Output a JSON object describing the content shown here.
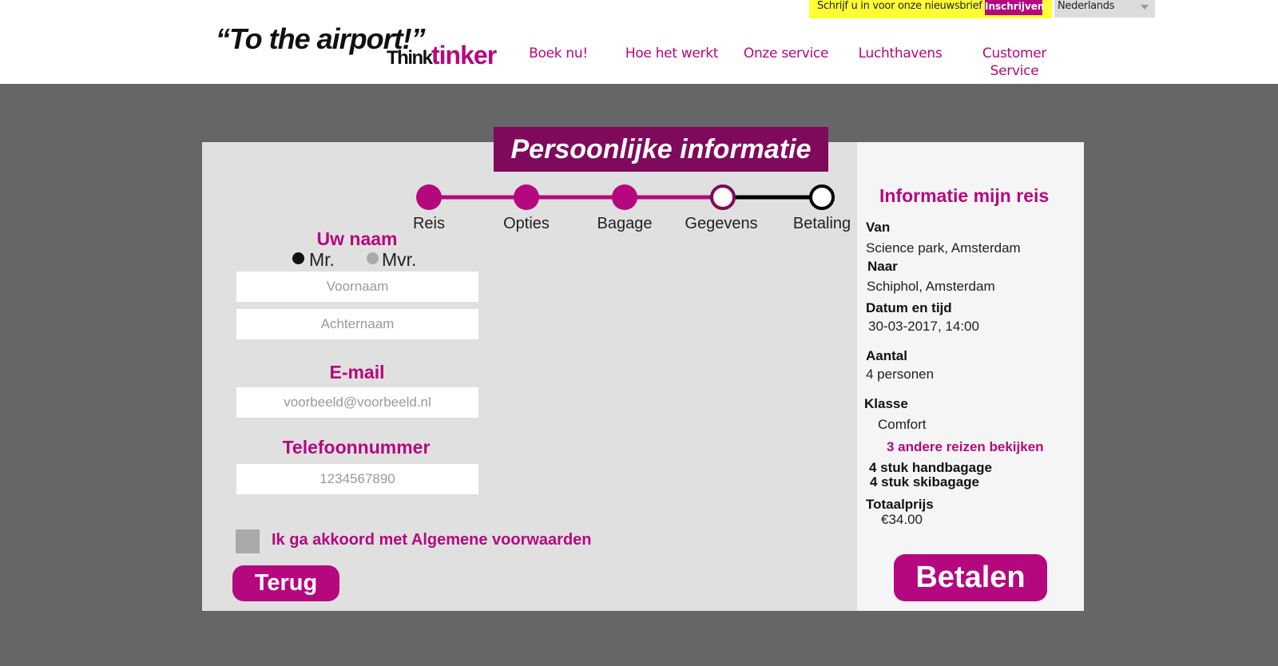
{
  "header": {
    "newsletter_text": "Schrijf u in voor onze nieuwsbrief",
    "newsletter_button": "Inschrijven",
    "language": "Nederlands",
    "logo_quote": "“To the airport!”",
    "logo_think": "Think",
    "logo_tinker": "tinker",
    "nav": [
      "Boek nu!",
      "Hoe het werkt",
      "Onze service",
      "Luchthavens",
      "Customer",
      "Service"
    ]
  },
  "page_title": "Persoonlijke informatie",
  "steps": [
    {
      "label": "Reis",
      "state": "done"
    },
    {
      "label": "Opties",
      "state": "done"
    },
    {
      "label": "Bagage",
      "state": "done"
    },
    {
      "label": "Gegevens",
      "state": "current"
    },
    {
      "label": "Betaling",
      "state": "todo"
    }
  ],
  "form": {
    "name_heading": "Uw naam",
    "title_options": [
      "Mr.",
      "Mvr."
    ],
    "title_selected": "Mr.",
    "first_name_placeholder": "Voornaam",
    "last_name_placeholder": "Achternaam",
    "email_heading": "E-mail",
    "email_placeholder": "voorbeeld@voorbeeld.nl",
    "phone_heading": "Telefoonnummer",
    "phone_placeholder": "1234567890",
    "agree_label": "Ik ga akkoord met Algemene voorwaarden",
    "back_button": "Terug"
  },
  "sidebar": {
    "title": "Informatie mijn reis",
    "from_label": "Van",
    "from_value": "Science park, Amsterdam",
    "to_label": "Naar",
    "to_value": "Schiphol, Amsterdam",
    "datetime_label": "Datum en tijd",
    "datetime_value": "30-03-2017, 14:00",
    "count_label": "Aantal",
    "count_value": "4 personen",
    "class_label": "Klasse",
    "class_value": "Comfort",
    "other_trips_link": "3 andere reizen bekijken",
    "hand_luggage": "4 stuk handbagage",
    "ski_luggage": "4 stuk skibagage",
    "total_label": "Totaalprijs",
    "total_value": "€34.00",
    "pay_button": "Betalen"
  },
  "colors": {
    "accent": "#b5087e",
    "title_banner": "#7f0a5c",
    "background": "#666666",
    "panel": "#e0e0e0",
    "newsletter_bg": "#ffff33"
  }
}
